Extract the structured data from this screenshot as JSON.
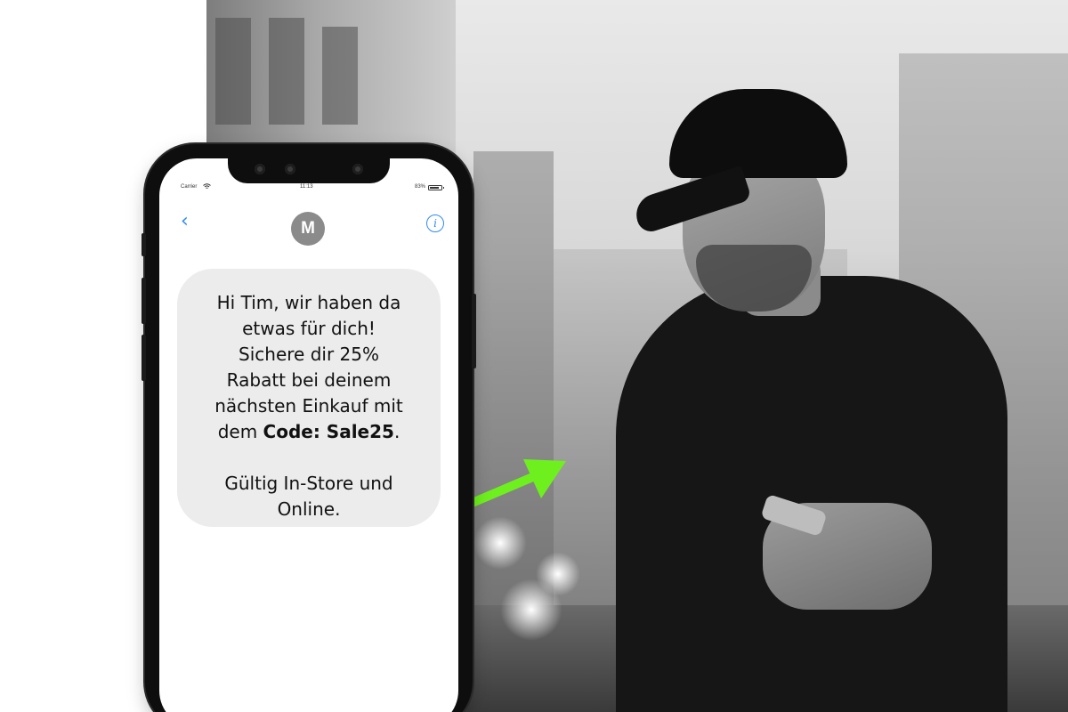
{
  "status_bar": {
    "carrier": "Carrier",
    "wifi_icon": "wifi-icon",
    "time": "11:13",
    "battery": "83%",
    "battery_icon": "battery-icon"
  },
  "conversation": {
    "back_icon": "chevron-left-icon",
    "back_glyph": "‹",
    "avatar_initial": "M",
    "info_icon": "info-icon",
    "info_glyph": "i"
  },
  "message": {
    "line1": "Hi Tim, wir haben da",
    "line2": "etwas für dich!",
    "line3": "Sichere dir 25%",
    "line4": "Rabatt bei deinem",
    "line5": "nächsten Einkauf mit",
    "line6_prefix": "dem ",
    "line6_code": "Code: Sale25",
    "line6_suffix": ".",
    "line7": "Gültig In-Store und",
    "line8": "Online."
  },
  "colors": {
    "arrow": "#6ef01e",
    "ios_blue": "#2f8cf0",
    "bubble": "#ececec",
    "avatar": "#8b8b8b"
  }
}
